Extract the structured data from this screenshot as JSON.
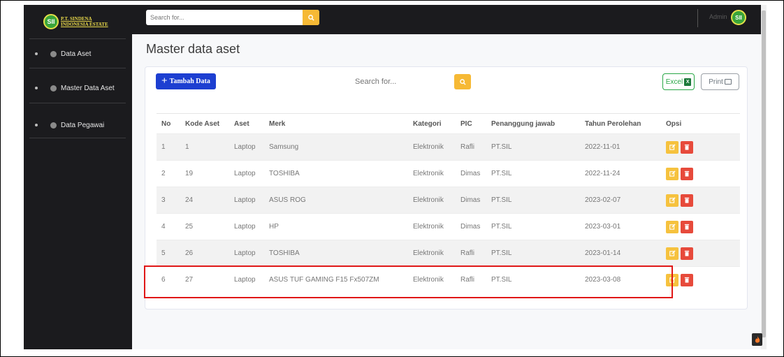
{
  "brand": {
    "logo_text": "SII",
    "line1": "P.T. SINDENA",
    "line2": "INDONESIA ESTATE"
  },
  "sidebar": {
    "items": [
      {
        "label": "Data Aset"
      },
      {
        "label": "Master Data Aset"
      },
      {
        "label": "Data Pegawai"
      }
    ]
  },
  "topbar": {
    "search_placeholder": "Search for...",
    "user_name": "Admin",
    "avatar_text": "SII"
  },
  "main": {
    "title": "Master data aset",
    "add_label": "Tambah Data",
    "search_placeholder": "Search for...",
    "excel_label": "Excel",
    "print_label": "Print"
  },
  "table": {
    "headers": [
      "No",
      "Kode Aset",
      "Aset",
      "Merk",
      "Kategori",
      "PIC",
      "Penanggung jawab",
      "Tahun Perolehan",
      "Opsi"
    ],
    "rows": [
      [
        "1",
        "1",
        "Laptop",
        "Samsung",
        "Elektronik",
        "Rafli",
        "PT.SIL",
        "2022-11-01"
      ],
      [
        "2",
        "19",
        "Laptop",
        "TOSHIBA",
        "Elektronik",
        "Dimas",
        "PT.SIL",
        "2022-11-24"
      ],
      [
        "3",
        "24",
        "Laptop",
        "ASUS ROG",
        "Elektronik",
        "Dimas",
        "PT.SIL",
        "2023-02-07"
      ],
      [
        "4",
        "25",
        "Laptop",
        "HP",
        "Elektronik",
        "Dimas",
        "PT.SIL",
        "2023-03-01"
      ],
      [
        "5",
        "26",
        "Laptop",
        "TOSHIBA",
        "Elektronik",
        "Rafli",
        "PT.SIL",
        "2023-01-14"
      ],
      [
        "6",
        "27",
        "Laptop",
        "ASUS TUF GAMING F15 Fx507ZM",
        "Elektronik",
        "Rafli",
        "PT.SIL",
        "2023-03-08"
      ]
    ]
  },
  "colors": {
    "accent_yellow": "#f6b935",
    "add_blue": "#1d3fd1",
    "edit": "#f6c23e",
    "delete": "#e74a3b",
    "highlight": "#e01717"
  }
}
